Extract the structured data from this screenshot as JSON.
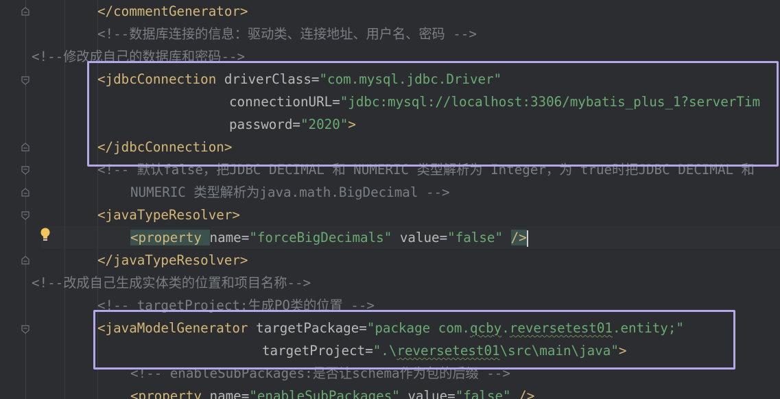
{
  "editor": {
    "language": "xml",
    "lines": [
      {
        "id": "l1",
        "tokens": [
          [
            "t",
            "</commentGenerator>"
          ]
        ]
      },
      {
        "id": "l2",
        "tokens": [
          [
            "c",
            "<!--数据库连接的信息：驱动类、连接地址、用户名、密码 -->"
          ]
        ]
      },
      {
        "id": "l3",
        "tokens": [
          [
            "c",
            "<!--修改成自己的数据库和密码-->"
          ]
        ]
      },
      {
        "id": "l4",
        "tokens": [
          [
            "t",
            "<jdbcConnection "
          ],
          [
            "a",
            "driverClass"
          ],
          [
            "p",
            "="
          ],
          [
            "v",
            "\"com.mysql.jdbc.Driver\""
          ]
        ]
      },
      {
        "id": "l5",
        "tokens": [
          [
            "a",
            "connectionURL"
          ],
          [
            "p",
            "="
          ],
          [
            "v",
            "\"jdbc:mysql://localhost:3306/mybatis_plus_1?serverTim"
          ]
        ]
      },
      {
        "id": "l6",
        "tokens": [
          [
            "a",
            "password"
          ],
          [
            "p",
            "="
          ],
          [
            "v",
            "\"2020\""
          ],
          [
            "t",
            ">"
          ]
        ]
      },
      {
        "id": "l7",
        "tokens": [
          [
            "t",
            "</jdbcConnection>"
          ]
        ]
      },
      {
        "id": "l8",
        "tokens": [
          [
            "c",
            "<!-- 默认false，把JDBC DECIMAL 和 NUMERIC 类型解析为 Integer，为 true时把JDBC DECIMAL 和"
          ]
        ]
      },
      {
        "id": "l9",
        "tokens": [
          [
            "c",
            "NUMERIC 类型解析为java.math.BigDecimal -->"
          ]
        ]
      },
      {
        "id": "l10",
        "tokens": [
          [
            "t",
            "<javaTypeResolver>"
          ]
        ]
      },
      {
        "id": "l11",
        "tokens": [
          [
            "t",
            "<property "
          ],
          [
            "a",
            "name"
          ],
          [
            "p",
            "="
          ],
          [
            "v",
            "\"forceBigDecimals\""
          ],
          [
            "p",
            " "
          ],
          [
            "a",
            "value"
          ],
          [
            "p",
            "="
          ],
          [
            "v",
            "\"false\""
          ],
          [
            "p",
            " "
          ],
          [
            "t",
            "/>"
          ]
        ]
      },
      {
        "id": "l12",
        "tokens": [
          [
            "t",
            "</javaTypeResolver>"
          ]
        ]
      },
      {
        "id": "l13",
        "tokens": [
          [
            "c",
            "<!--改成自己生成实体类的位置和项目名称-->"
          ]
        ]
      },
      {
        "id": "l14",
        "tokens": [
          [
            "c",
            "<!-- targetProject:生成PO类的位置 -->"
          ]
        ]
      },
      {
        "id": "l15",
        "tokens": [
          [
            "t",
            "<javaModelGenerator "
          ],
          [
            "a",
            "targetPackage"
          ],
          [
            "p",
            "="
          ],
          [
            "v",
            "\"package com."
          ],
          [
            "vs",
            "qcby"
          ],
          [
            "v",
            "."
          ],
          [
            "vs",
            "reversetest01"
          ],
          [
            "v",
            ".entity;\""
          ]
        ]
      },
      {
        "id": "l16",
        "tokens": [
          [
            "a",
            "targetProject"
          ],
          [
            "p",
            "="
          ],
          [
            "v",
            "\".\\"
          ],
          [
            "vs",
            "reversetest01"
          ],
          [
            "v",
            "\\src\\main\\java\""
          ],
          [
            "t",
            ">"
          ]
        ]
      },
      {
        "id": "l17",
        "tokens": [
          [
            "c",
            "<!-- enableSubPackages:是否让schema作为包的后缀 -->"
          ]
        ]
      },
      {
        "id": "l18",
        "tokens": [
          [
            "t",
            "<property "
          ],
          [
            "a",
            "name"
          ],
          [
            "p",
            "="
          ],
          [
            "v",
            "\"enableSubPackages\""
          ],
          [
            "p",
            " "
          ],
          [
            "a",
            "value"
          ],
          [
            "p",
            "="
          ],
          [
            "v",
            "\"false\""
          ],
          [
            "p",
            " "
          ],
          [
            "t",
            "/>"
          ]
        ]
      }
    ]
  },
  "icons": {
    "fold": "fold-marker-icon",
    "bulb": "lightbulb-icon"
  },
  "colors": {
    "background": "#2b2d30",
    "tag": "#d5b778",
    "attribute": "#bababa",
    "value": "#6aab73",
    "comment": "#7a7e85",
    "highlight_box": "#b5a8ea"
  }
}
